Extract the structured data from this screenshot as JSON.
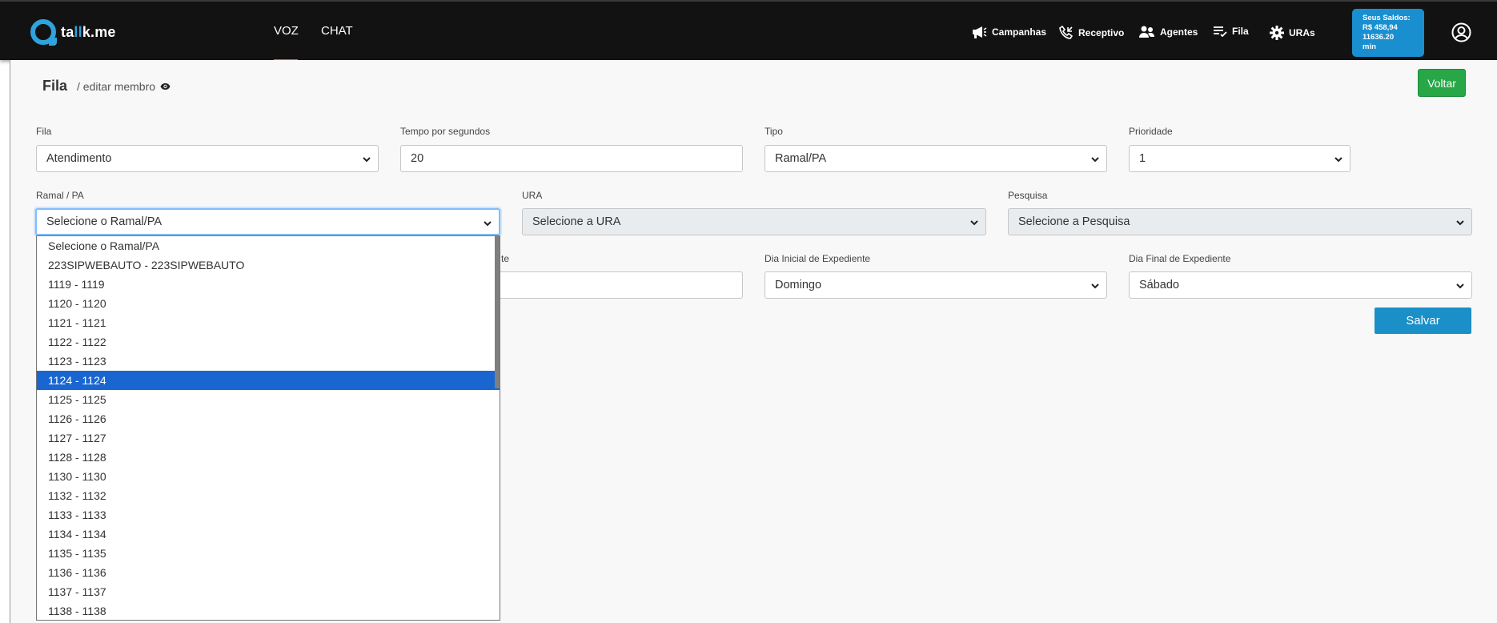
{
  "header": {
    "logo_text_pre": "ta",
    "logo_text_hl": "ll",
    "logo_text_post": "k.me",
    "tabs": [
      {
        "label": "VOZ",
        "active": true
      },
      {
        "label": "CHAT",
        "active": false
      }
    ],
    "menu": [
      {
        "label": "Campanhas",
        "icon": "megaphone-icon"
      },
      {
        "label": "Receptivo",
        "icon": "phone-incoming-icon"
      },
      {
        "label": "Agentes",
        "icon": "users-icon"
      },
      {
        "label": "Fila",
        "icon": "queue-list-icon"
      },
      {
        "label": "URAs",
        "icon": "gear-icon"
      }
    ],
    "saldo": {
      "line1": "Seus Saldos:",
      "line2": "R$ 458,94",
      "line3": "11636.20",
      "line4": "min"
    }
  },
  "page": {
    "title": "Fila",
    "subtitle": "/ editar membro",
    "voltar_label": "Voltar",
    "salvar_label": "Salvar"
  },
  "form": {
    "fila": {
      "label": "Fila",
      "value": "Atendimento"
    },
    "tempo": {
      "label": "Tempo por segundos",
      "value": "20"
    },
    "tipo": {
      "label": "Tipo",
      "value": "Ramal/PA"
    },
    "prioridade": {
      "label": "Prioridade",
      "value": "1"
    },
    "ramal": {
      "label": "Ramal / PA",
      "value": "Selecione o Ramal/PA"
    },
    "ura": {
      "label": "URA",
      "value": "Selecione a URA"
    },
    "pesquisa": {
      "label": "Pesquisa",
      "value": "Selecione a Pesquisa"
    },
    "hidden_label_tail": "te",
    "dia_inicial": {
      "label": "Dia Inicial de Expediente",
      "value": "Domingo"
    },
    "dia_final": {
      "label": "Dia Final de Expediente",
      "value": "Sábado"
    }
  },
  "dropdown": {
    "selected_index": 7,
    "options": [
      "Selecione o Ramal/PA",
      "223SIPWEBAUTO - 223SIPWEBAUTO",
      "1119 - 1119",
      "1120 - 1120",
      "1121 - 1121",
      "1122 - 1122",
      "1123 - 1123",
      "1124 - 1124",
      "1125 - 1125",
      "1126 - 1126",
      "1127 - 1127",
      "1128 - 1128",
      "1130 - 1130",
      "1132 - 1132",
      "1133 - 1133",
      "1134 - 1134",
      "1135 - 1135",
      "1136 - 1136",
      "1137 - 1137",
      "1138 - 1138"
    ]
  }
}
